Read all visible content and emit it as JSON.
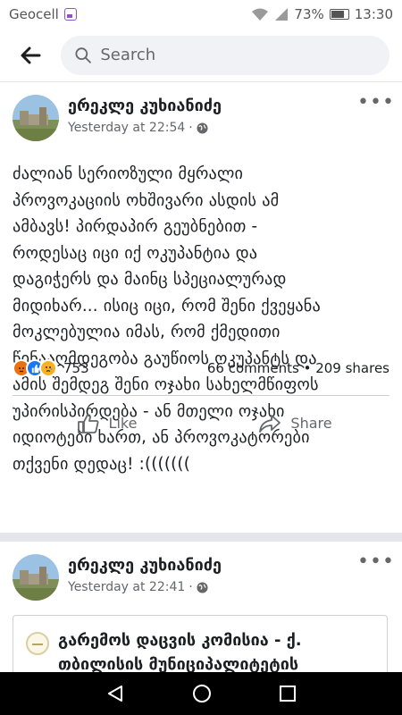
{
  "status_bar": {
    "carrier": "Geocell",
    "battery": "73%",
    "time": "13:30"
  },
  "search": {
    "placeholder": "Search"
  },
  "post": {
    "author": "ერეკლე კუხიანიძე",
    "timestamp": "Yesterday at 22:54",
    "privacy_separator": "·",
    "text": "ძალიან სერიოზული მყრალი\nპროვოკაციის ოხშივარი ასდის ამ\nამბავს! პირდაპირ გეუბნებით -\nროდესაც იცი იქ ოკუპანტია და\nდაგიჭერს და მაინც სპეციალურად\nმიდიხარ... ისიც იცი, რომ შენი ქვეყანა\nმოკლებულია იმას, რომ ქმედითი\nწინააღმდეგობა გაუწიოს ოკუპანტს და\nამის შემდეგ შენი ოჯახი სახელმწიფოს\nუპირისპირდება - ან მთელი ოჯახი\nიდიოტები ხართ, ან პროვოკატორები\nთქვენი დედაც! :(((((((",
    "reaction_count": "753",
    "comments": "66 comments",
    "dot": "•",
    "shares": "209 shares",
    "like_label": "Like",
    "share_label": "Share"
  },
  "post2": {
    "author": "ერეკლე კუხიანიძე",
    "timestamp": "Yesterday at 22:41",
    "privacy_separator": "·",
    "shared_title": "გარემოს დაცვის კომისია - ქ.\nთბილისის მუნიციპალიტეტის"
  },
  "colors": {
    "angry": "#e9710f",
    "like": "#1877f2",
    "sad": "#f7b125",
    "secondary_text": "#65676b",
    "divider": "#e4e6eb"
  }
}
